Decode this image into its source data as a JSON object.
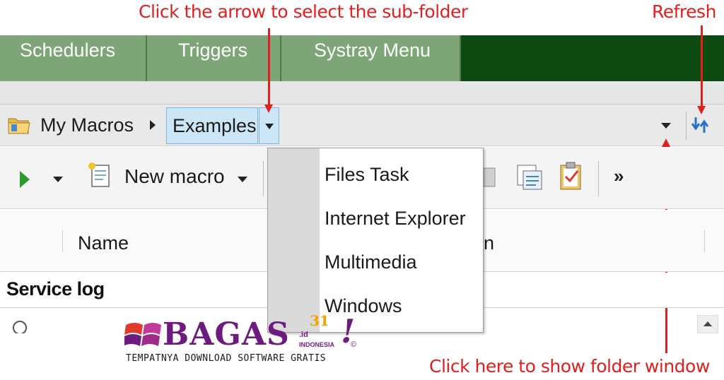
{
  "annotations": {
    "select_subfolder": "Click the arrow to select the sub-folder",
    "refresh": "Refresh",
    "folder_window": "Click here to show folder window"
  },
  "tabs": [
    {
      "label": "Schedulers"
    },
    {
      "label": "Triggers"
    },
    {
      "label": "Systray Menu"
    }
  ],
  "addressbar": {
    "root_label": "My Macros",
    "active_label": "Examples"
  },
  "toolbar": {
    "new_macro_label": "New macro",
    "overflow_label": "»"
  },
  "columns": {
    "name_label": "Name",
    "second_label_fragment": "n"
  },
  "service_log": {
    "title": "Service log"
  },
  "dropdown": {
    "items": [
      {
        "label": "Files Task"
      },
      {
        "label": "Internet Explorer"
      },
      {
        "label": "Multimedia"
      },
      {
        "label": "Windows"
      }
    ]
  },
  "watermark": {
    "word": "BAGAS",
    "superscript": "31",
    "suffix": ".id",
    "country": "INDONESIA",
    "exclaim": "!",
    "copyright": "©",
    "tagline": "TEMPATNYA DOWNLOAD SOFTWARE GRATIS"
  },
  "colors": {
    "annotation": "#e0201f",
    "tab_green": "#7ea578",
    "tab_dark": "#0c4a12",
    "selection": "#cde6f7",
    "logo_purple": "#6d1b7e"
  }
}
